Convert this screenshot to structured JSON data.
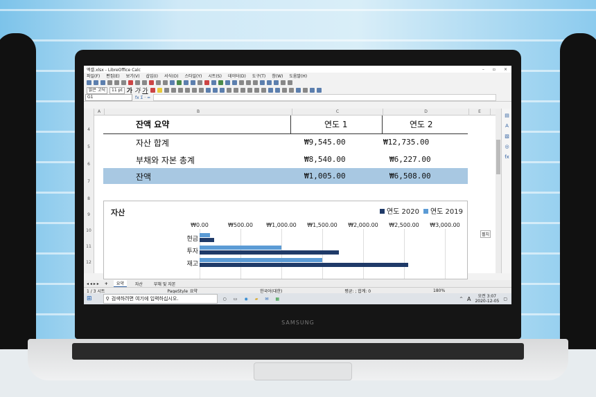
{
  "window": {
    "title": "엑셀.xlsx - LibreOffice Calc",
    "controls": [
      "–",
      "▫",
      "×"
    ]
  },
  "menu": [
    "파일(F)",
    "편집(E)",
    "보기(V)",
    "삽입(I)",
    "서식(O)",
    "스타일(Y)",
    "시트(S)",
    "데이터(D)",
    "도구(T)",
    "창(W)",
    "도움말(H)"
  ],
  "toolbar": {
    "font_name": "맑은 고딕",
    "font_size": "11 pt",
    "bold": "가",
    "italic": "가",
    "underline": "가"
  },
  "formula_bar": {
    "cell_ref": "G1",
    "fx": "fx Σ · ="
  },
  "columns": [
    "A",
    "B",
    "C",
    "D",
    "E"
  ],
  "rows": [
    "4",
    "5",
    "6",
    "7",
    "8",
    "9",
    "10",
    "11",
    "12"
  ],
  "table": {
    "title": "잔액 요약",
    "col1": "연도 1",
    "col2": "연도 2",
    "rows": [
      {
        "label": "자산 합계",
        "y1": "₩9,545.00",
        "y2": "₩12,735.00"
      },
      {
        "label": "부채와 자본 총계",
        "y1": "₩8,540.00",
        "y2": "₩6,227.00"
      },
      {
        "label": "잔액",
        "y1": "₩1,005.00",
        "y2": "₩6,508.00"
      }
    ]
  },
  "chart_data": {
    "type": "bar",
    "title": "자산",
    "orientation": "horizontal",
    "categories": [
      "현금",
      "투자",
      "재고"
    ],
    "series": [
      {
        "name": "연도 2020",
        "color": "#1f3a68",
        "values": [
          180,
          1700,
          2550
        ]
      },
      {
        "name": "연도 2019",
        "color": "#5b9bd5",
        "values": [
          130,
          1000,
          1500
        ]
      }
    ],
    "xticks": [
      "₩0.00",
      "₩500.00",
      "₩1,000.00",
      "₩1,500.00",
      "₩2,000.00",
      "₩2,500.00",
      "₩3,000.00"
    ],
    "xlim": [
      0,
      3000
    ],
    "legend": "top-right"
  },
  "sidebar_button": "펼치",
  "sheets": {
    "tabs": [
      "요약",
      "자산",
      "부채 및 자본"
    ],
    "active": 0,
    "add": "+"
  },
  "status": {
    "sheet": "1 / 3 시트",
    "page_style": "PageStyle_요약",
    "language": "한국어(대한)",
    "sum": "평균: ; 합계: 0",
    "zoom": "180%"
  },
  "taskbar": {
    "search_placeholder": "검색하려면 여기에 입력하십시오.",
    "ime": "A",
    "time": "오전 3:07",
    "date": "2020-12-05"
  },
  "laptop_brand": "SAMSUNG"
}
